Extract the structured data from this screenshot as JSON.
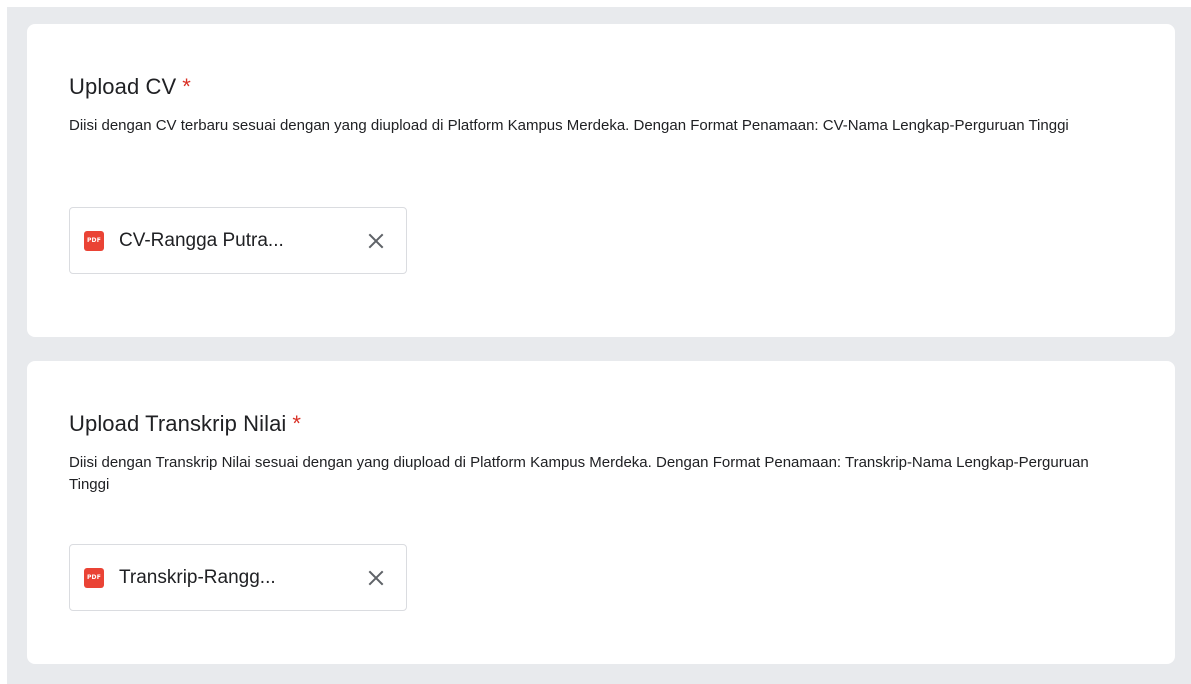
{
  "questions": [
    {
      "title": "Upload CV",
      "required_mark": "*",
      "description": "Diisi dengan CV terbaru sesuai dengan yang diupload di Platform Kampus Merdeka. Dengan Format Penamaan: CV-Nama Lengkap-Perguruan Tinggi",
      "file": {
        "icon_label": "PDF",
        "name": "CV-Rangga Putra..."
      }
    },
    {
      "title": "Upload Transkrip Nilai",
      "required_mark": "*",
      "description": "Diisi dengan Transkrip Nilai sesuai dengan yang diupload di Platform Kampus Merdeka. Dengan Format Penamaan: Transkrip-Nama Lengkap-Perguruan Tinggi",
      "file": {
        "icon_label": "PDF",
        "name": "Transkrip-Rangg..."
      }
    }
  ],
  "colors": {
    "background": "#e8eaed",
    "card": "#ffffff",
    "text": "#202124",
    "required": "#d93025",
    "pdf_icon": "#ea4335",
    "chip_border": "#dadce0",
    "close_icon": "#5f6368"
  },
  "icons": {
    "file_type": "pdf-icon",
    "remove": "close-icon"
  }
}
